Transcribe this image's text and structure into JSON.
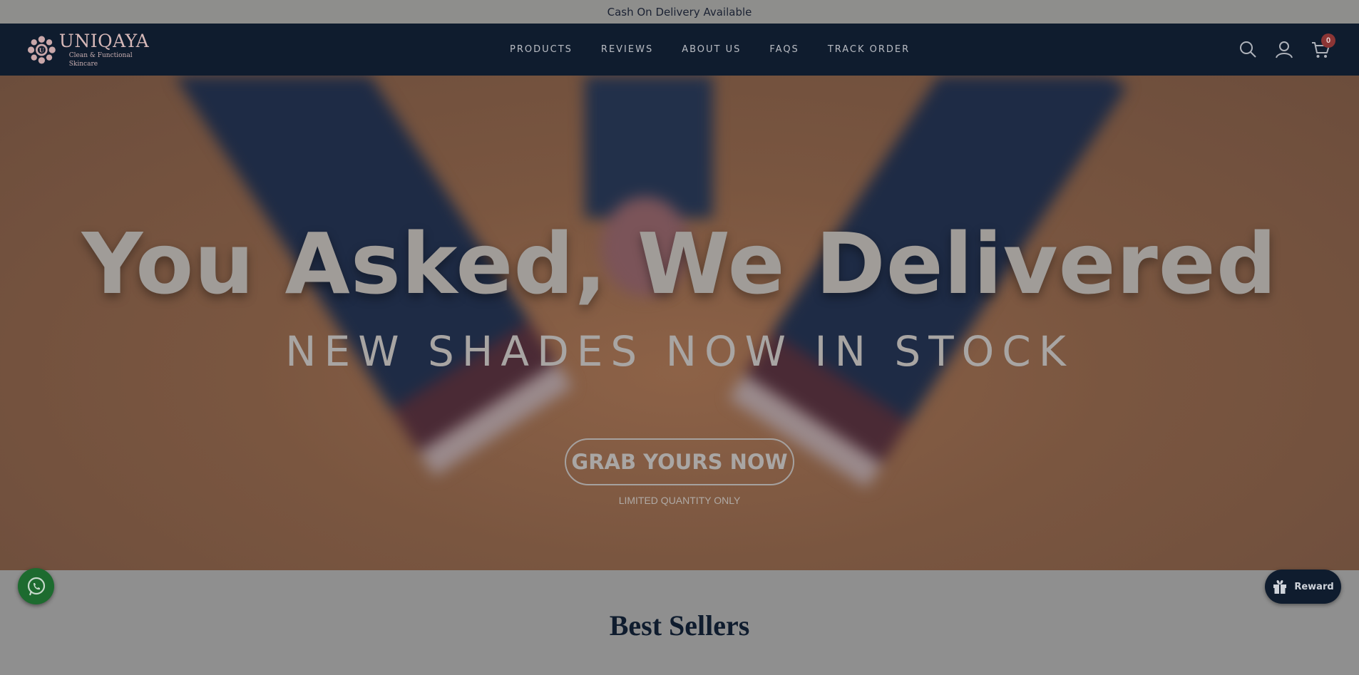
{
  "announcement": {
    "text": "Cash On Delivery Available"
  },
  "header": {
    "logo": {
      "name": "UNIQAYA",
      "tagline": "Clean & Functional Skincare"
    },
    "nav": [
      {
        "label": "PRODUCTS"
      },
      {
        "label": "REVIEWS"
      },
      {
        "label": "ABOUT US"
      },
      {
        "label": "FAQS"
      },
      {
        "label": "TRACK ORDER"
      }
    ],
    "icons": [
      "search-icon",
      "account-icon",
      "cart-icon"
    ],
    "cart_count": "0"
  },
  "hero": {
    "title": "You Asked, We Delivered",
    "subtitle": "NEW SHADES NOW IN STOCK",
    "cta_label": "GRAB YOURS NOW",
    "note": "LIMITED QUANTITY ONLY"
  },
  "best_sellers": {
    "title": "Best Sellers"
  },
  "floating": {
    "whatsapp_icon": "whatsapp-icon",
    "reward_label": "Reward",
    "reward_icon": "gift-icon"
  },
  "colors": {
    "header_bg": "#0f1c2e",
    "overlay": "#8f8f8f",
    "cart_badge": "#8c3535",
    "whatsapp": "#1d6b2f"
  }
}
